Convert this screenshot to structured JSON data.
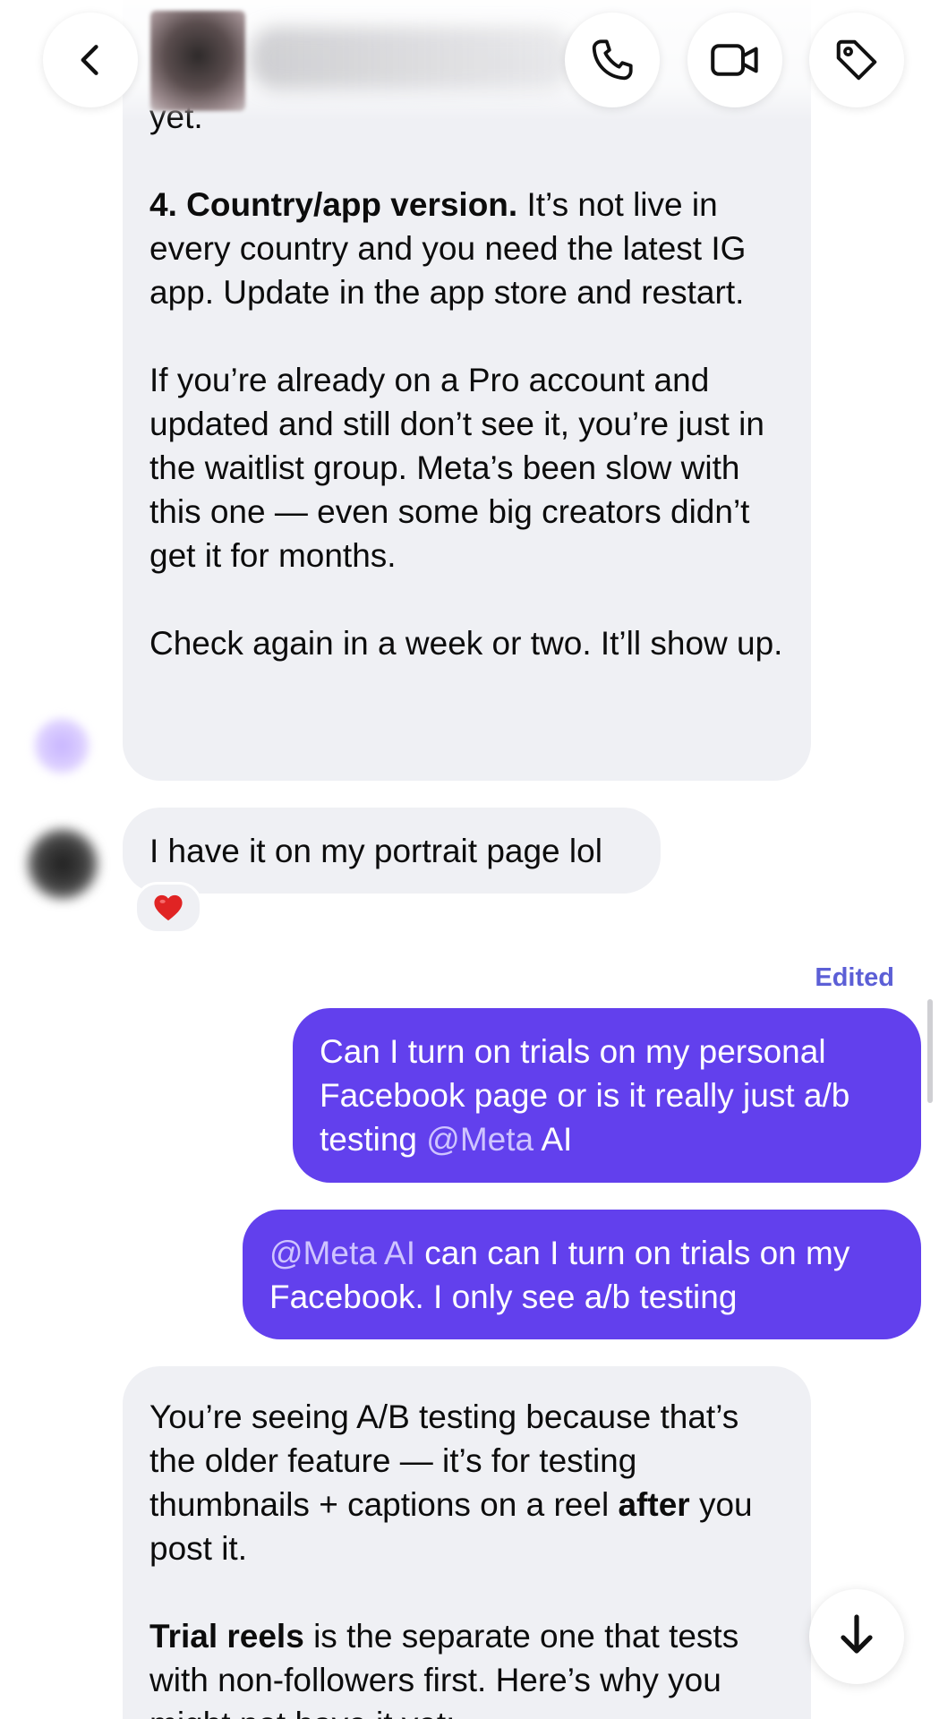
{
  "colors": {
    "incoming_bubble": "#eff0f4",
    "outgoing_bubble": "#6240ed",
    "mention": "#cfc4ff",
    "edited_label": "#5c5fd6",
    "reaction_heart": "#e02424"
  },
  "header": {
    "back_icon": "chevron-left-icon",
    "call_icon": "phone-icon",
    "video_icon": "video-camera-icon",
    "tag_icon": "tag-icon"
  },
  "messages": {
    "ai_reply_1": {
      "top_fragment": "yet.",
      "p1_bold": "4. Country/app version.",
      "p1_text": " It’s not live in every country and you need the latest IG app. Update in the app store and restart.",
      "p2": "If you’re already on a Pro account and updated and still don’t see it, you’re just in the waitlist group. Meta’s been slow with this one — even some big creators didn’t get it for months.",
      "p3": "Check again in a week or two. It’ll show up."
    },
    "incoming_1": {
      "text": "I have it on my portrait page lol",
      "reaction": "❤️"
    },
    "edited_label": "Edited",
    "outgoing_1": {
      "text": "Can I turn on trials on my personal Facebook page or is it really just a/b testing ",
      "mention": "@Meta",
      "tail": " AI"
    },
    "outgoing_2": {
      "mention": "@Meta AI",
      "text": " can can I turn on trials on my Facebook. I only see a/b testing"
    },
    "ai_reply_2": {
      "p1_text": "You’re seeing A/B testing because that’s the older feature — it’s for testing thumbnails + captions on a reel ",
      "p1_bold": "after",
      "p1_tail": " you post it.",
      "p2_bold": "Trial reels",
      "p2_text": " is the separate one that tests with non-followers first. Here’s why you might not have it yet:"
    }
  },
  "footer": {
    "scroll_down_icon": "arrow-down-icon"
  }
}
